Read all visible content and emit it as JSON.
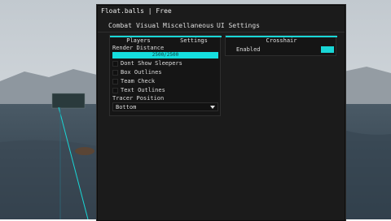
{
  "window": {
    "title": "Float.balls | Free",
    "tabs": [
      "Combat",
      "Visual",
      "Miscellaneous",
      "UI Settings"
    ]
  },
  "left_panel": {
    "tabs": [
      "Players",
      "Settings"
    ],
    "render_distance_label": "Render Distance",
    "render_distance_value": "2500/2500",
    "checkboxes": [
      "Dont Show Sleepers",
      "Box Outlines",
      "Team Check",
      "Text Outlines"
    ],
    "tracer_position_label": "Tracer Position",
    "tracer_position_value": "Bottom"
  },
  "right_panel": {
    "title": "Crosshair",
    "enabled_label": "Enabled",
    "enabled_color": "#19d6d6"
  },
  "accent_color": "#19d6d6"
}
